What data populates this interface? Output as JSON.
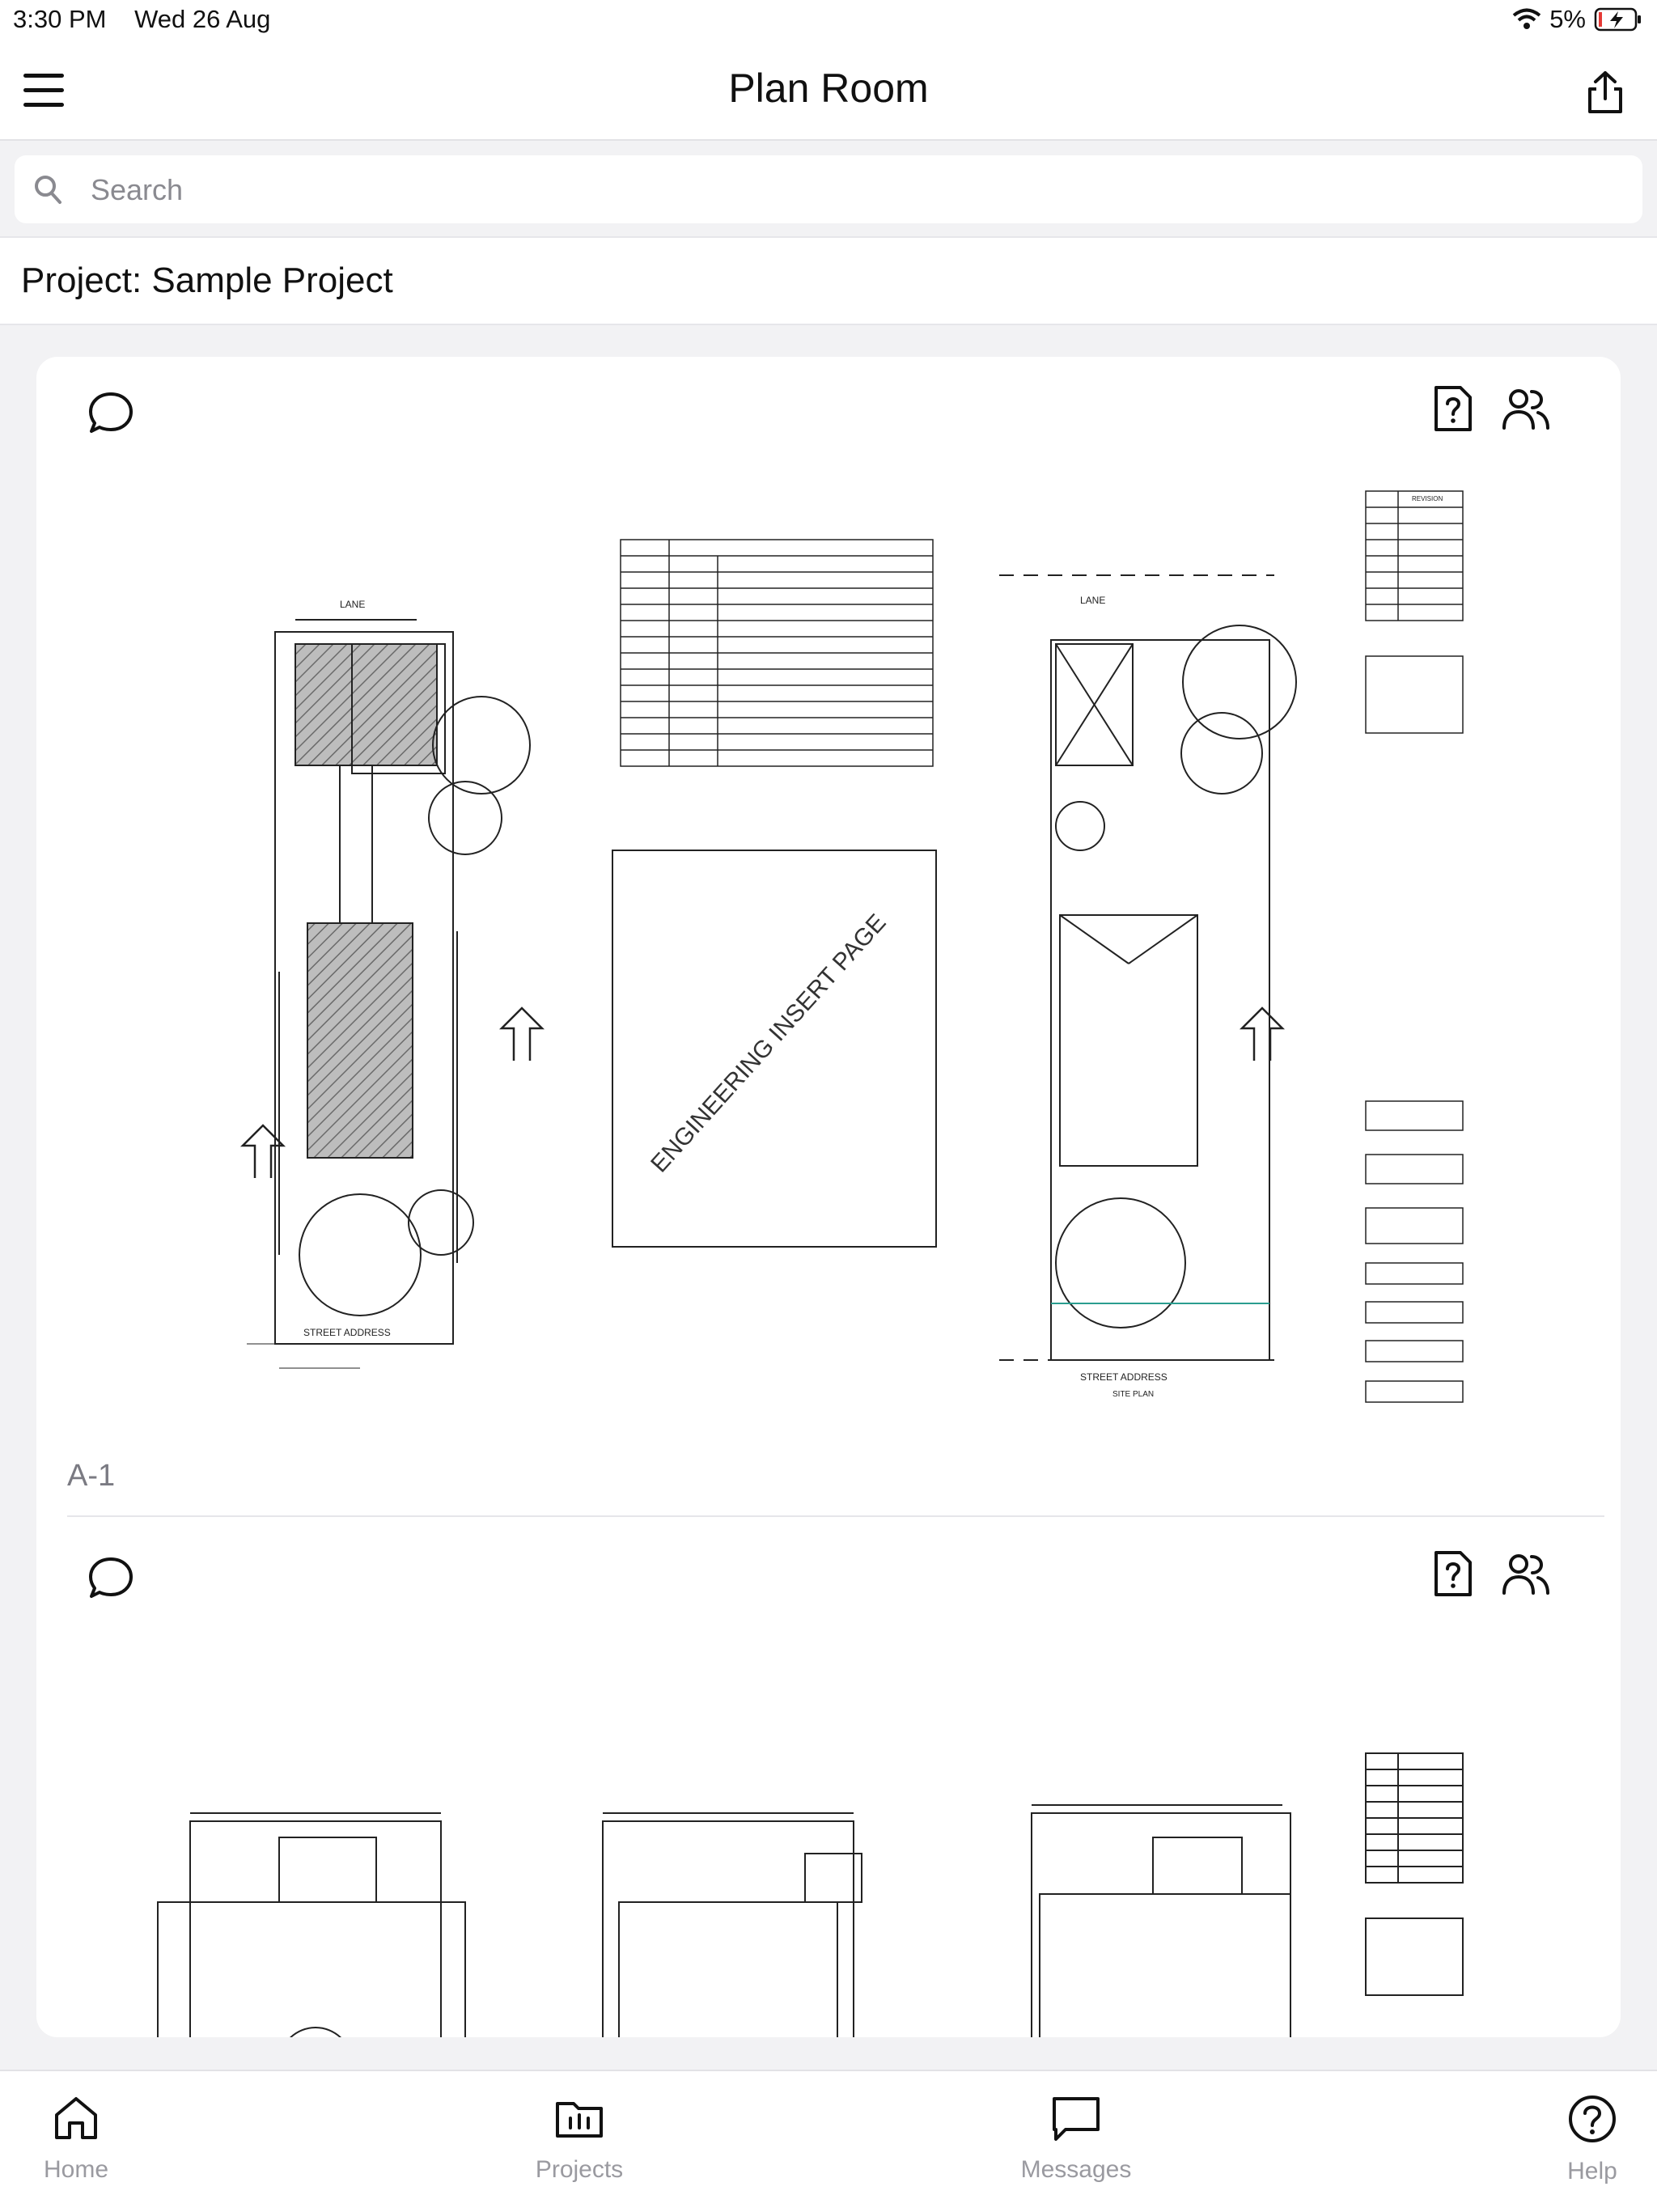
{
  "status_bar": {
    "time": "3:30 PM",
    "date": "Wed 26 Aug",
    "battery": "5%"
  },
  "nav": {
    "title": "Plan Room",
    "menu_icon": "hamburger-menu-icon",
    "share_icon": "share-icon"
  },
  "search": {
    "placeholder": "Search",
    "value": ""
  },
  "project": {
    "label": "Project: Sample Project"
  },
  "sheets": [
    {
      "label": "A-1",
      "drawing_text": {
        "lane": "LANE",
        "street_address": "STREET ADDRESS",
        "engineering_insert": "ENGINEERING INSERT PAGE",
        "site_plan": "SITE PLAN",
        "revision": "REVISION"
      }
    },
    {
      "label": ""
    }
  ],
  "tabs": [
    {
      "label": "Home",
      "icon": "home-icon"
    },
    {
      "label": "Projects",
      "icon": "projects-folder-icon"
    },
    {
      "label": "Messages",
      "icon": "messages-icon"
    },
    {
      "label": "Help",
      "icon": "help-icon"
    }
  ]
}
